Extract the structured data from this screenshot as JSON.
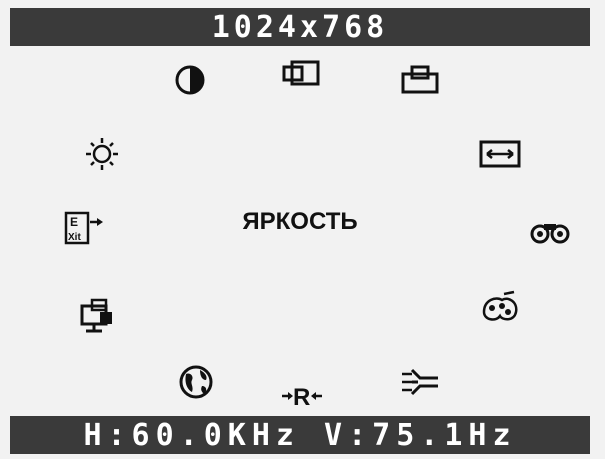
{
  "osd": {
    "title": "1024x768",
    "selected_item": "ЯРКОСТЬ",
    "status": "H:60.0KHz V:75.1Hz",
    "menu_icons": [
      "contrast-icon",
      "h-position-icon",
      "v-position-icon",
      "brightness-icon",
      "h-size-icon",
      "exit-icon",
      "geometry-icon",
      "recall-icon",
      "color-icon",
      "language-icon",
      "reset-icon",
      "input-icon"
    ],
    "colors": {
      "bar_background": "#3a3a3a",
      "bar_text": "#ffffff",
      "panel_background": "#f2f2f2",
      "icon_color": "#111111"
    }
  }
}
